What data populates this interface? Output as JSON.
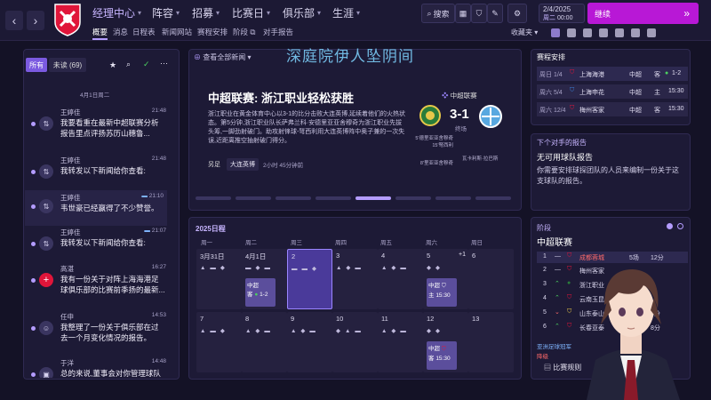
{
  "nav": {
    "main_items": [
      "经理中心",
      "阵容",
      "招募",
      "比赛日",
      "俱乐部",
      "生涯"
    ],
    "sub_items": [
      "概要",
      "消息",
      "日程表",
      "新闻网站",
      "赛程安排",
      "阶段",
      "对手报告"
    ],
    "collections_label": "收藏夹",
    "search_label": "搜索",
    "date": "2/4/2025",
    "weekday": "周二",
    "time": "00:00",
    "continue_label": "继续",
    "back_arrow": "‹",
    "forward_arrow": "›"
  },
  "inbox": {
    "tabs": {
      "all": "所有",
      "unread": "未读 (69)"
    },
    "date_header": "4月1日周二",
    "messages": [
      {
        "sender": "王婷佳",
        "time": "21:48",
        "line1": "我要看重在最新中超联赛分析",
        "line2": "报告里点评扬苏历山穗鲁..."
      },
      {
        "sender": "王婷佳",
        "time": "21:48",
        "line1": "我转发以下新闻给你查看:",
        "line2": ""
      },
      {
        "sender": "王婷佳",
        "time": "21:10",
        "line1": "韦世豪已经赢得了不少赞誉。",
        "line2": ""
      },
      {
        "sender": "王婷佳",
        "time": "21:07",
        "line1": "我转发以下新闻给你查看:",
        "line2": ""
      },
      {
        "sender": "高湛",
        "time": "16:27",
        "line1": "我有一份关于对阵上海海港足",
        "line2": "球俱乐部的比赛前季扬的最新..."
      },
      {
        "sender": "任申",
        "time": "14:53",
        "line1": "我整理了一份关于俱乐部在过",
        "line2": "去一个月变化情况的报告。"
      },
      {
        "sender": "于洋",
        "time": "14:48",
        "line1": "总的来说,董事会对你管理球队",
        "line2": "的愉悦状况感到..."
      }
    ]
  },
  "news": {
    "header_link": "查看全部新闻",
    "overlay_title": "深庭院伊人坠阴间",
    "headline": "中超联赛: 浙江职业轻松获胜",
    "competition": "中超联赛",
    "body": "浙江职业在黄金体育中心以3-1的比分击败大连英博,延续着他们的火热状态。第5分钟,浙江职业队长萨弗兰科·安德里亚亚舍穆奇为浙江职业先拔头筹,一脚劲射破门。助攻射锋球-弩西利用大连英博阵中奥子兼的一次失误,近距离推空抽射破门得分。",
    "tag": "另足",
    "team_label": "大连英博",
    "time_ago": "2小时 45分钟前",
    "score": "3-1",
    "score_status": "终场",
    "scorers_left": [
      "5'德里亚亚舍穆奇",
      "15'弩西利",
      "50'德",
      "8'里亚亚舍穆奇"
    ],
    "scorer_right": "瓦卡利斯·拉巴斯"
  },
  "fixtures": {
    "title": "赛程安排",
    "rows": [
      {
        "date": "周日 1/4",
        "team": "上海海港",
        "comp": "中超",
        "venue": "客",
        "result": "1-2"
      },
      {
        "date": "周六 5/4",
        "team": "上海申花",
        "comp": "中超",
        "venue": "主",
        "result": "15:30"
      },
      {
        "date": "周六 12/4",
        "team": "梅州客家",
        "comp": "中超",
        "venue": "客",
        "result": "15:30"
      }
    ]
  },
  "opponent": {
    "title": "下个对手的报告",
    "subtitle": "无可用球队报告",
    "body": "你需要安排球探团队的人员来编制一份关于这支球队的报告。"
  },
  "calendar": {
    "title": "2025日程",
    "weekdays": [
      "周一",
      "周二",
      "周三",
      "周四",
      "周五",
      "周六",
      "周日"
    ],
    "week1": [
      "3月31日",
      "4月1日",
      "2",
      "3",
      "4",
      "5",
      "6"
    ],
    "week2": [
      "7",
      "8",
      "9",
      "10",
      "11",
      "12",
      "13"
    ],
    "extra_plus": "+1",
    "matches": [
      {
        "comp": "中超",
        "venue": "客",
        "result": "1-2"
      },
      {
        "comp": "中超",
        "venue": "主",
        "result": "15:30"
      },
      {
        "comp": "中超",
        "venue": "客",
        "result": "15:30"
      }
    ]
  },
  "stage": {
    "title": "阶段",
    "league": "中超联赛",
    "rows": [
      {
        "pos": "1",
        "team": "成都蓉城",
        "played": "5场",
        "pts": "12分"
      },
      {
        "pos": "2",
        "team": "梅州客家",
        "played": "",
        "pts": ""
      },
      {
        "pos": "3",
        "team": "浙江职业",
        "played": "",
        "pts": ""
      },
      {
        "pos": "4",
        "team": "云南玉昆",
        "played": "",
        "pts": ""
      },
      {
        "pos": "5",
        "team": "山东泰山",
        "played": "",
        "pts": "8分"
      },
      {
        "pos": "6",
        "team": "长春亚泰",
        "played": "",
        "pts": "8分"
      }
    ],
    "note": "亚洲足球冠军",
    "note2": "降级",
    "footer_link": "比赛规则"
  },
  "colors": {
    "accent": "#b818d6",
    "purple": "#b49cff",
    "bg": "#141226",
    "panel": "#1d1a36"
  }
}
